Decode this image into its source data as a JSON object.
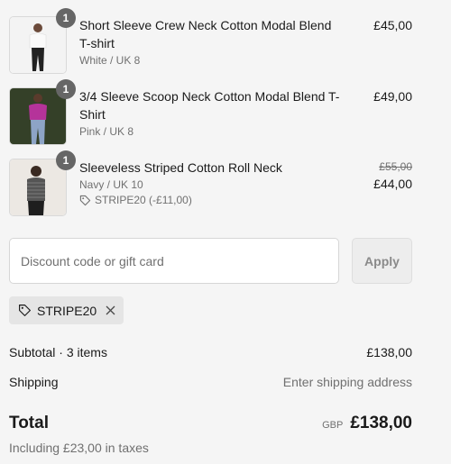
{
  "line_items": [
    {
      "name": "Short Sleeve Crew Neck Cotton Modal Blend T-shirt",
      "variant": "White / UK 8",
      "quantity": "1",
      "price": "£45,00",
      "image": "white-tshirt-model-image"
    },
    {
      "name": "3/4 Sleeve Scoop Neck Cotton Modal Blend T-Shirt",
      "variant": "Pink / UK 8",
      "quantity": "1",
      "price": "£49,00",
      "image": "pink-top-model-image"
    },
    {
      "name": "Sleeveless Striped Cotton Roll Neck",
      "variant": "Navy / UK 10",
      "quantity": "1",
      "original_price": "£55,00",
      "price": "£44,00",
      "discount": "STRIPE20 (-£11,00)",
      "image": "striped-rollneck-model-image"
    }
  ],
  "discount_form": {
    "placeholder": "Discount code or gift card",
    "value": "",
    "apply_label": "Apply"
  },
  "applied_code": {
    "code": "STRIPE20",
    "icon": "tag-icon",
    "remove_icon": "close-icon"
  },
  "summary": {
    "subtotal_label": "Subtotal · 3 items",
    "subtotal_value": "£138,00",
    "shipping_label": "Shipping",
    "shipping_value": "Enter shipping address",
    "total_label": "Total",
    "currency": "GBP",
    "total_value": "£138,00",
    "taxes_note": "Including £23,00 in taxes"
  },
  "colors": {
    "background": "#f5f5f5",
    "badge": "#666666",
    "muted_text": "#707070",
    "chip_bg": "#e5e5e5"
  }
}
